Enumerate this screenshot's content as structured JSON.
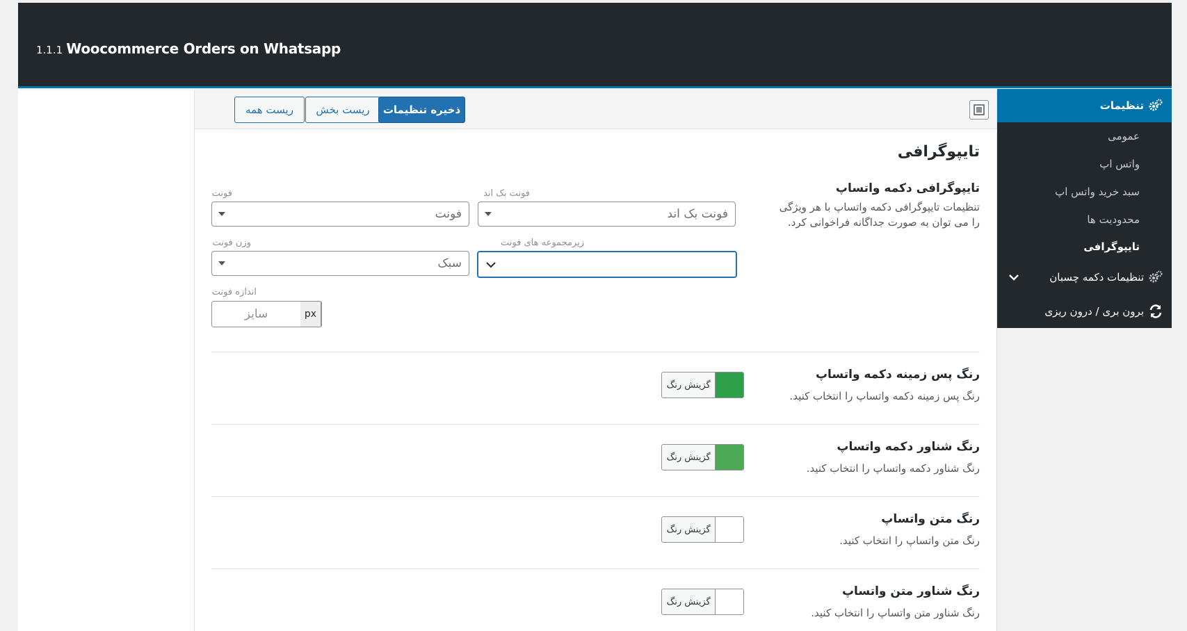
{
  "header": {
    "version": "1.1.1",
    "plugin_name": "Woocommerce Orders on Whatsapp"
  },
  "sidebar": {
    "settings_label": "تنظیمات",
    "items": [
      {
        "label": "عمومی"
      },
      {
        "label": "واتس اپ"
      },
      {
        "label": "سبد خرید واتس اپ"
      },
      {
        "label": "محدودیت ها"
      },
      {
        "label": "تایپوگرافی"
      }
    ],
    "sticky_label": "تنظیمات دکمه چسبان",
    "import_export_label": "برون بری / درون ریزی"
  },
  "toolbar": {
    "save_label": "ذخیره تنظیمات",
    "reset_section_label": "ریست بخش",
    "reset_all_label": "ریست همه"
  },
  "section": {
    "title": "تایپوگرافی"
  },
  "typography": {
    "label": "تایپوگرافی دکمه واتساپ",
    "description": "تنظیمات تایپوگرافی دکمه واتساپ با هر ویژگی را می توان به صورت جداگانه فراخوانی کرد.",
    "font_label": "فونت",
    "font_value": "فونت",
    "backup_font_label": "فونت بک اند",
    "backup_font_value": "فونت بک اند",
    "font_weight_label": "وزن فونت",
    "font_weight_value": "سبک",
    "font_subset_label": "زیرمجموعه های فونت",
    "font_size_label": "اندازه فونت",
    "font_size_unit": "px",
    "font_size_placeholder": "سایز"
  },
  "colors": [
    {
      "label": "رنگ پس زمینه دکمه واتساپ",
      "description": "رنگ پس زمینه دکمه واتساپ را انتخاب کنید.",
      "button": "گزینش رنگ",
      "swatch": "#2ea04a"
    },
    {
      "label": "رنگ شناور دکمه واتساپ",
      "description": "رنگ شناور دکمه واتساپ را انتخاب کنید.",
      "button": "گزینش رنگ",
      "swatch": "#4caa55"
    },
    {
      "label": "رنگ متن واتساپ",
      "description": "رنگ متن واتساپ را انتخاب کنید.",
      "button": "گزینش رنگ",
      "swatch": "#ffffff"
    },
    {
      "label": "رنگ شناور متن واتساپ",
      "description": "رنگ شناور متن واتساپ را انتخاب کنید.",
      "button": "گزینش رنگ",
      "swatch": "#ffffff"
    }
  ]
}
